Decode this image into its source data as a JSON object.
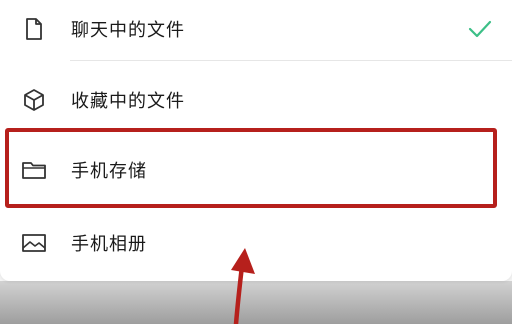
{
  "menu": {
    "items": [
      {
        "label": "聊天中的文件",
        "icon": "document-icon",
        "selected": true
      },
      {
        "label": "收藏中的文件",
        "icon": "cube-icon",
        "selected": false
      },
      {
        "label": "手机存储",
        "icon": "folder-icon",
        "selected": false
      },
      {
        "label": "手机相册",
        "icon": "image-icon",
        "selected": false
      }
    ]
  },
  "colors": {
    "check": "#3cbf87",
    "highlight": "#b6201c",
    "text": "#1a1a1a",
    "icon": "#333333"
  }
}
